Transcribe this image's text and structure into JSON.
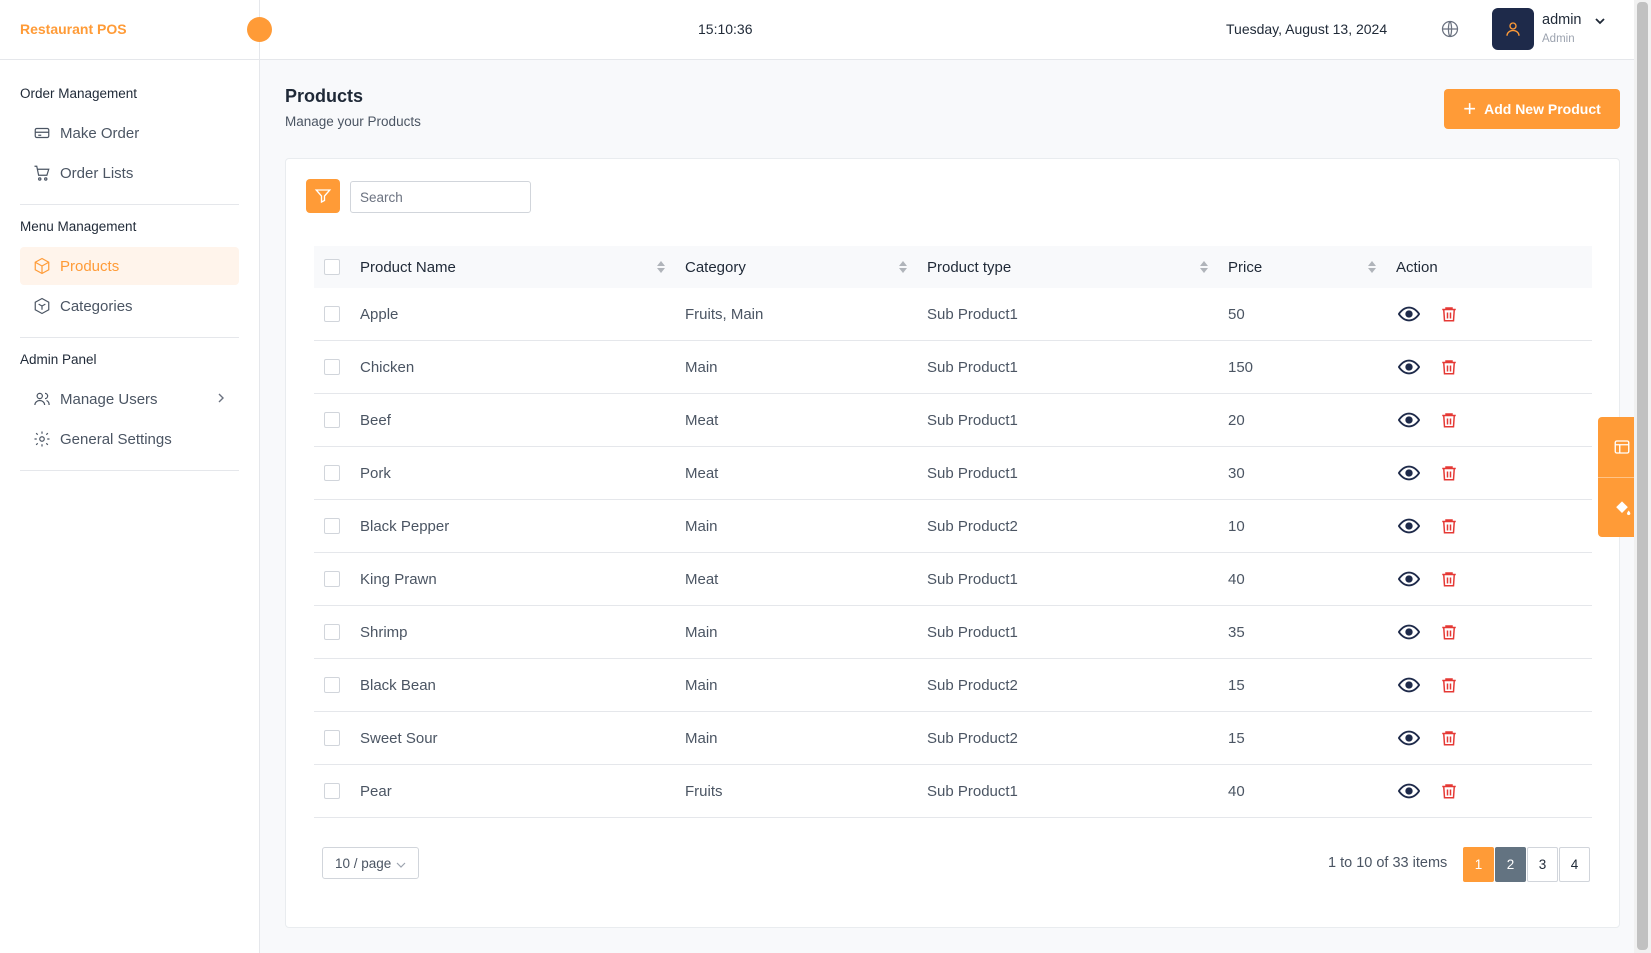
{
  "app": {
    "brand": "Restaurant POS"
  },
  "topbar": {
    "time": "15:10:36",
    "date": "Tuesday, August 13, 2024",
    "user": {
      "name": "admin",
      "role": "Admin"
    }
  },
  "sidebar": {
    "sections": [
      {
        "heading": "Order Management",
        "items": [
          {
            "label": "Make Order",
            "icon": "make-order-icon"
          },
          {
            "label": "Order Lists",
            "icon": "cart-icon"
          }
        ]
      },
      {
        "heading": "Menu Management",
        "items": [
          {
            "label": "Products",
            "icon": "box-icon",
            "active": true
          },
          {
            "label": "Categories",
            "icon": "categories-icon"
          }
        ]
      },
      {
        "heading": "Admin Panel",
        "items": [
          {
            "label": "Manage Users",
            "icon": "users-icon",
            "has_submenu": true
          },
          {
            "label": "General Settings",
            "icon": "gear-icon"
          }
        ]
      }
    ]
  },
  "page": {
    "title": "Products",
    "subtitle": "Manage your Products",
    "add_button": "Add New Product",
    "search_placeholder": "Search"
  },
  "table": {
    "columns": [
      "Product Name",
      "Category",
      "Product type",
      "Price",
      "Action"
    ],
    "rows": [
      {
        "name": "Apple",
        "category": "Fruits, Main",
        "type": "Sub Product1",
        "price": "50"
      },
      {
        "name": "Chicken",
        "category": "Main",
        "type": "Sub Product1",
        "price": "150"
      },
      {
        "name": "Beef",
        "category": "Meat",
        "type": "Sub Product1",
        "price": "20"
      },
      {
        "name": "Pork",
        "category": "Meat",
        "type": "Sub Product1",
        "price": "30"
      },
      {
        "name": "Black Pepper",
        "category": "Main",
        "type": "Sub Product2",
        "price": "10"
      },
      {
        "name": "King Prawn",
        "category": "Meat",
        "type": "Sub Product1",
        "price": "40"
      },
      {
        "name": "Shrimp",
        "category": "Main",
        "type": "Sub Product1",
        "price": "35"
      },
      {
        "name": "Black Bean",
        "category": "Main",
        "type": "Sub Product2",
        "price": "15"
      },
      {
        "name": "Sweet Sour",
        "category": "Main",
        "type": "Sub Product2",
        "price": "15"
      },
      {
        "name": "Pear",
        "category": "Fruits",
        "type": "Sub Product1",
        "price": "40"
      }
    ]
  },
  "pagination": {
    "page_size": "10 / page",
    "range_text": "1 to 10 of 33 items",
    "pages": [
      "1",
      "2",
      "3",
      "4"
    ],
    "current": "1"
  },
  "colors": {
    "accent": "#ff9b37",
    "danger": "#e53935",
    "navy": "#1e2a4a"
  }
}
